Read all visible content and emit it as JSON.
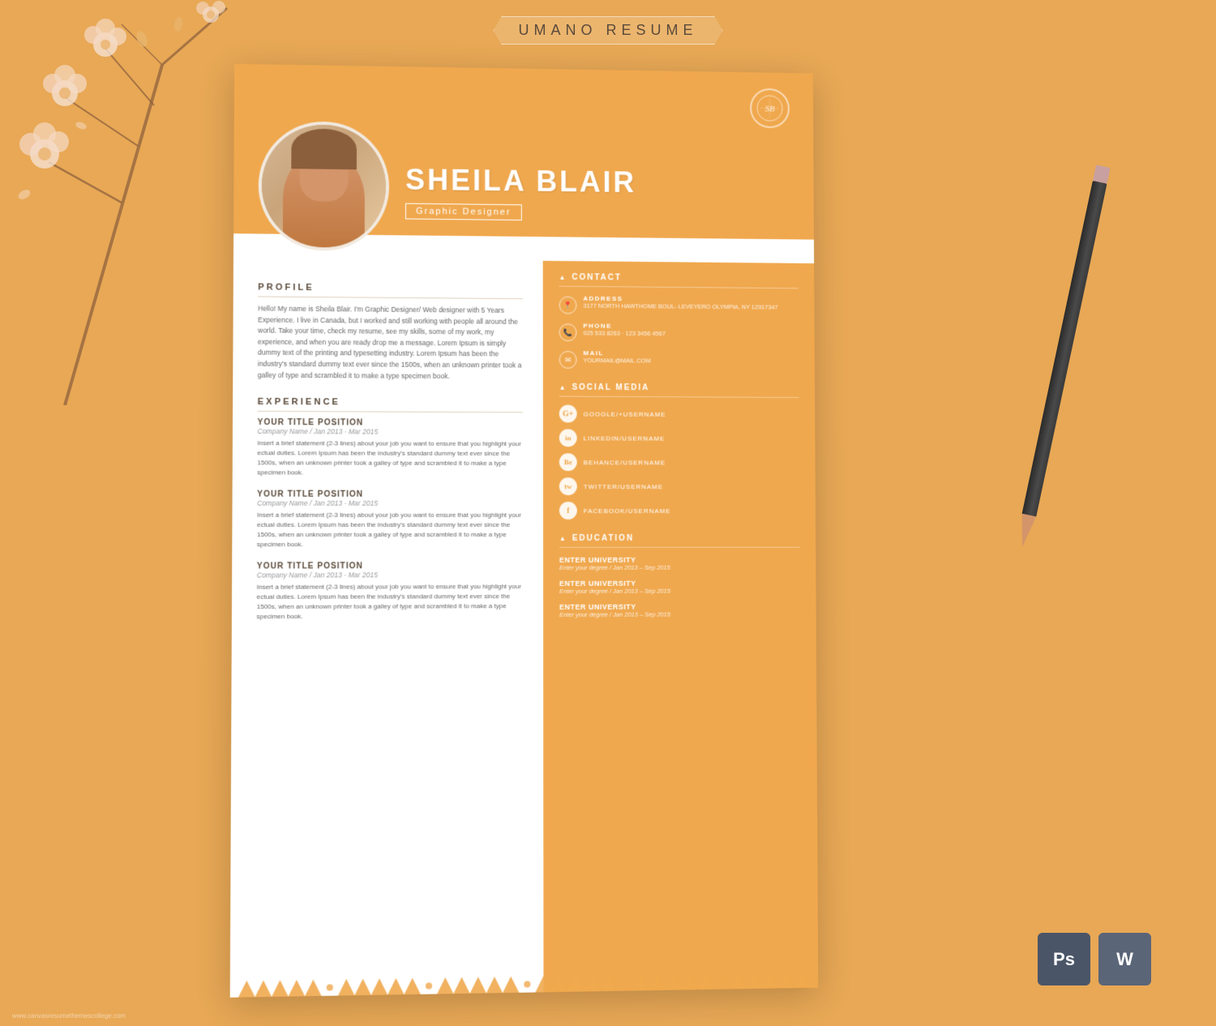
{
  "banner": {
    "title": "UMANO  RESUME"
  },
  "resume": {
    "name": "SHEILA BLAIR",
    "title": "Graphic Designer",
    "logo_initials": "SB",
    "profile": {
      "heading": "PROFILE",
      "text": "Hello! My name is Sheila Blair. I'm Graphic Designer/ Web designer with 5 Years Experience. I live in Canada, but I worked and still working with people all around the world. Take your time, check my resume, see my skills, some of my work, my experience, and when you are ready drop me a message. Lorem Ipsum is simply dummy text of the printing and typesetting industry. Lorem Ipsum has been the industry's standard dummy text ever since the 1500s, when an unknown printer took a galley of type and scrambled it to make a type specimen book."
    },
    "experience": {
      "heading": "EXPERIENCE",
      "items": [
        {
          "title": "YOUR TITLE POSITION",
          "company": "Company Name / Jan 2013 - Mar 2015",
          "desc": "Insert a brief statement (2-3 lines) about your job you want to ensure that you highlight your ectual duties. Lorem Ipsum has been the industry's standard dummy text ever since the 1500s, when an unknown printer took a galley of type and scrambled it to make a type specimen book."
        },
        {
          "title": "YOUR TITLE POSITION",
          "company": "Company Name / Jan 2013 - Mar 2015",
          "desc": "Insert a brief statement (2-3 lines) about your job you want to ensure that you highlight your ectual duties. Lorem Ipsum has been the industry's standard dummy text ever since the 1500s, when an unknown printer took a galley of type and scrambled it to make a type specimen book."
        },
        {
          "title": "YOUR TITLE POSITION",
          "company": "Company Name / Jan 2013 - Mar 2015",
          "desc": "Insert a brief statement (2-3 lines) about your job you want to ensure that you highlight your ectual duties. Lorem Ipsum has been the industry's standard dummy text ever since the 1500s, when an unknown printer took a galley of type and scrambled it to make a type specimen book."
        }
      ]
    },
    "contact": {
      "heading": "CONTACT",
      "address_label": "ADDRESS",
      "address_value": "3177 NORTH HAWTHOME BOUL-\nLEVEYERO OLYMPIA, NY 12917347",
      "phone_label": "PHONE",
      "phone_value": "925 533 8263 · 123 3456 4567",
      "mail_label": "MAIL",
      "mail_value": "YOURMAIL@MAIL.COM"
    },
    "social": {
      "heading": "SOCIAL MEDIA",
      "items": [
        {
          "icon": "G+",
          "label": "GOOGLE/+USERNAME"
        },
        {
          "icon": "in",
          "label": "LINKEDIN/USERNAME"
        },
        {
          "icon": "Be",
          "label": "BEHANCE/USERNAME"
        },
        {
          "icon": "🐦",
          "label": "TWITTER/USERNAME"
        },
        {
          "icon": "f",
          "label": "FACEBOOK/USERNAME"
        }
      ]
    },
    "education": {
      "heading": "EDUCATION",
      "items": [
        {
          "uni": "ENTER UNIVERSITY",
          "detail": "Enter your degree / Jan 2013 – Sep 2015"
        },
        {
          "uni": "ENTER UNIVERSITY",
          "detail": "Enter your degree / Jan 2013 – Sep 2015"
        },
        {
          "uni": "ENTER UNIVERSITY",
          "detail": "Enter your degree / Jan 2013 – Sep 2015"
        }
      ]
    }
  },
  "badges": {
    "ps_label": "Ps",
    "w_label": "W"
  },
  "watermark": "www.canvasresumethemescollege.com"
}
